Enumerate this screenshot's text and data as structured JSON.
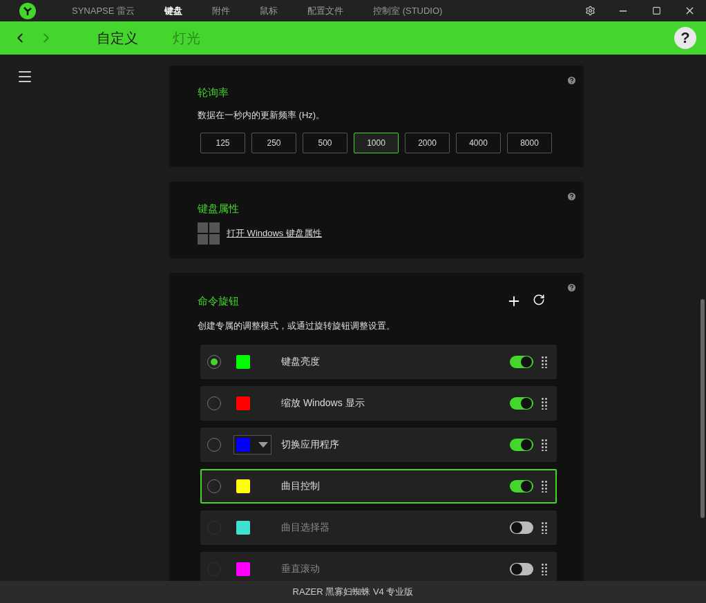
{
  "title_bar": {
    "tabs": [
      {
        "label": "SYNAPSE 雷云",
        "selected": false
      },
      {
        "label": "键盘",
        "selected": true
      },
      {
        "label": "附件",
        "selected": false
      },
      {
        "label": "鼠标",
        "selected": false
      },
      {
        "label": "配置文件",
        "selected": false
      },
      {
        "label": "控制室 (STUDIO)",
        "selected": false
      }
    ]
  },
  "sub_nav": {
    "tabs": [
      {
        "label": "自定义",
        "selected": true
      },
      {
        "label": "灯光",
        "selected": false
      }
    ],
    "help": "?"
  },
  "polling_rate": {
    "title": "轮询率",
    "description": "数据在一秒内的更新频率 (Hz)。",
    "options": [
      {
        "label": "125",
        "selected": false
      },
      {
        "label": "250",
        "selected": false
      },
      {
        "label": "500",
        "selected": false
      },
      {
        "label": "1000",
        "selected": true
      },
      {
        "label": "2000",
        "selected": false
      },
      {
        "label": "4000",
        "selected": false
      },
      {
        "label": "8000",
        "selected": false
      }
    ]
  },
  "keyboard_properties": {
    "title": "键盘属性",
    "link": "打开 Windows 键盘属性"
  },
  "command_dial": {
    "title": "命令旋钮",
    "description": "创建专属的调整模式，或通过旋转旋钮调整设置。",
    "modes": [
      {
        "kind": "plain",
        "label": "键盘亮度",
        "color": "#00ff00",
        "selected": true,
        "on": true,
        "focused": false
      },
      {
        "kind": "plain",
        "label": "缩放 Windows 显示",
        "color": "#ff0000",
        "selected": false,
        "on": true,
        "focused": false
      },
      {
        "kind": "dropdown",
        "label": "切换应用程序",
        "color": "#0000ff",
        "selected": false,
        "on": true,
        "focused": false
      },
      {
        "kind": "plain",
        "label": "曲目控制",
        "color": "#ffff00",
        "selected": false,
        "on": true,
        "focused": true
      },
      {
        "kind": "plain",
        "label": "曲目选择器",
        "color": "#40e0d0",
        "selected": false,
        "on": false,
        "focused": false
      },
      {
        "kind": "plain",
        "label": "垂直滚动",
        "color": "#ff00ff",
        "selected": false,
        "on": false,
        "focused": false
      }
    ]
  },
  "status_bar": {
    "device": "RAZER 黑寡妇蜘蛛 V4 专业版"
  }
}
